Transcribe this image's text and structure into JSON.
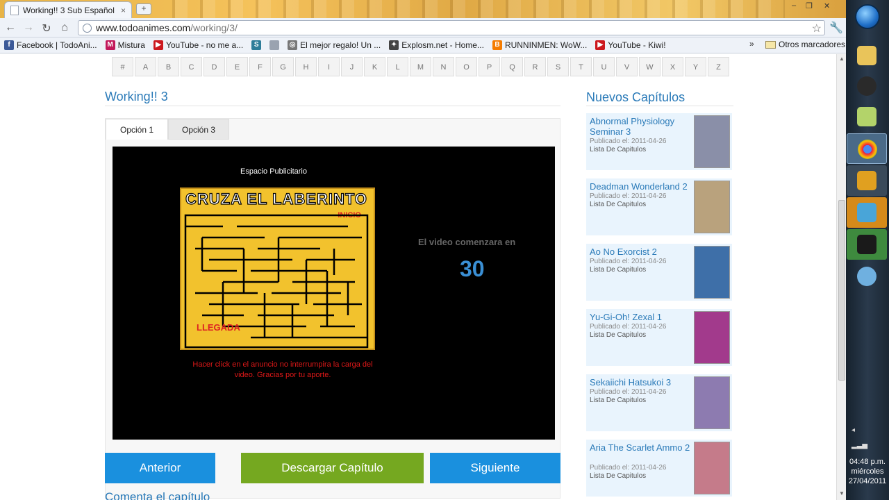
{
  "browser": {
    "tab_title": "Working!! 3 Sub Español ...",
    "tab_close": "×",
    "new_tab": "+",
    "window_controls": [
      "–",
      "❐",
      "✕"
    ],
    "url_domain": "www.todoanimes.com",
    "url_path": "/working/3/",
    "back": "←",
    "forward": "→",
    "reload": "↻",
    "home": "⌂",
    "star": "☆",
    "wrench": "🔧",
    "bookmarks": [
      {
        "label": "Facebook | TodoAni...",
        "icon": "facebook-icon",
        "color": "#3b5998",
        "glyph": "f"
      },
      {
        "label": "Mistura",
        "icon": "mistura-icon",
        "color": "#c2185b",
        "glyph": "M"
      },
      {
        "label": "YouTube - no me a...",
        "icon": "youtube-icon",
        "color": "#cc181e",
        "glyph": "▶"
      },
      {
        "label": "",
        "icon": "scribd-icon",
        "color": "#2e7d99",
        "glyph": "S"
      },
      {
        "label": "",
        "icon": "page-icon",
        "color": "#9aa3b0",
        "glyph": ""
      },
      {
        "label": "El mejor regalo! Un ...",
        "icon": "gift-icon",
        "color": "#777777",
        "glyph": "◎"
      },
      {
        "label": "Explosm.net - Home...",
        "icon": "explosm-icon",
        "color": "#444444",
        "glyph": "✦"
      },
      {
        "label": "RUNNINMEN: WoW...",
        "icon": "blogger-icon",
        "color": "#f57c00",
        "glyph": "B"
      },
      {
        "label": "YouTube - Kiwi!",
        "icon": "youtube-icon",
        "color": "#cc181e",
        "glyph": "▶"
      }
    ],
    "bookmarks_more": "»",
    "other_bookmarks": "Otros marcadores"
  },
  "alphabet": [
    "#",
    "A",
    "B",
    "C",
    "D",
    "E",
    "F",
    "G",
    "H",
    "I",
    "J",
    "K",
    "L",
    "M",
    "N",
    "O",
    "P",
    "Q",
    "R",
    "S",
    "T",
    "U",
    "V",
    "W",
    "X",
    "Y",
    "Z"
  ],
  "main": {
    "title": "Working!! 3",
    "tabs": [
      {
        "label": "Opción 1"
      },
      {
        "label": "Opción 3"
      }
    ],
    "player": {
      "ad_label": "Espacio Publicitario",
      "ad_title": "CRUZA EL LABERINTO",
      "ad_start": "INICIO",
      "ad_end": "LLEGADA",
      "ad_note": "Hacer click en el anuncio no interrumpira la carga del video. Gracias por tu aporte.",
      "countdown_label": "El video comenzara en",
      "countdown": "30"
    },
    "buttons": {
      "prev": "Anterior",
      "download": "Descargar Capítulo",
      "next": "Siguiente"
    },
    "comment_title": "Comenta el capítulo"
  },
  "sidebar": {
    "title": "Nuevos Capítulos",
    "items": [
      {
        "title": "Abnormal Physiology Seminar 3",
        "published": "Publicado el: 2011-04-26",
        "list": "Lista De Capitulos",
        "thumb": "#8a8fa8"
      },
      {
        "title": "Deadman Wonderland 2",
        "published": "Publicado el: 2011-04-26",
        "list": "Lista De Capitulos",
        "thumb": "#b9a27d"
      },
      {
        "title": "Ao No Exorcist 2",
        "published": "Publicado el: 2011-04-26",
        "list": "Lista De Capitulos",
        "thumb": "#3e6fa8"
      },
      {
        "title": "Yu-Gi-Oh! Zexal 1",
        "published": "Publicado el: 2011-04-26",
        "list": "Lista De Capitulos",
        "thumb": "#a23a8c"
      },
      {
        "title": "Sekaiichi Hatsukoi 3",
        "published": "Publicado el: 2011-04-26",
        "list": "Lista De Capitulos",
        "thumb": "#8d7bb0"
      },
      {
        "title": "Aria The Scarlet Ammo 2",
        "published": "Publicado el: 2011-04-26",
        "list": "Lista De Capitulos",
        "thumb": "#c57b8a"
      }
    ]
  },
  "taskbar": {
    "time": "04:48 p.m.",
    "day": "miércoles",
    "date": "27/04/2011",
    "tray_arrow": "◂"
  },
  "colors": {
    "accent": "#2a7ab8",
    "button_blue": "#1a90de",
    "button_green": "#75a820"
  }
}
